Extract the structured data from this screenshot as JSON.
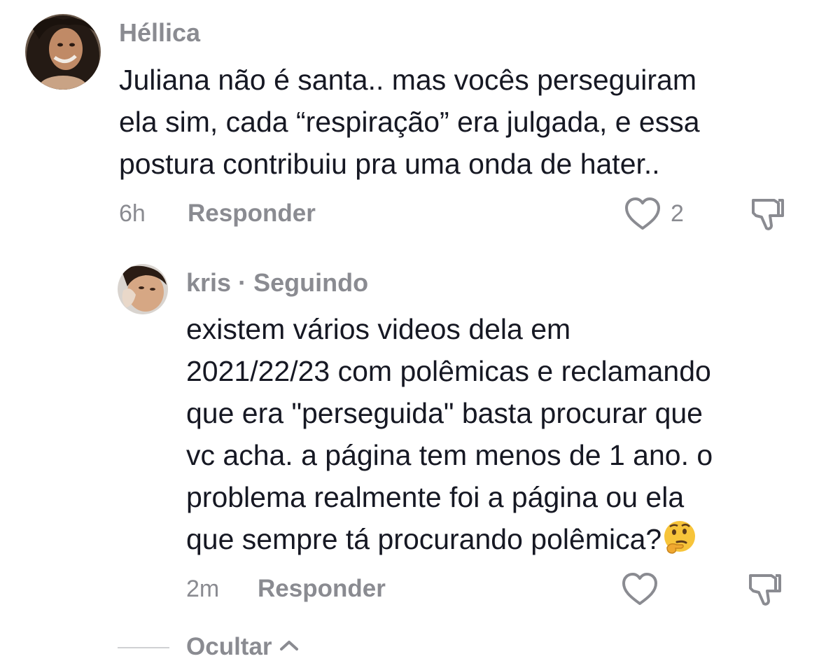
{
  "comment": {
    "author": "Héllica",
    "text": "Juliana não é santa.. mas vocês perseguiram\nela sim, cada “respiração” era julgada, e essa\npostura contribuiu pra uma onda de hater..",
    "time": "6h",
    "reply_label": "Responder",
    "likes": "2",
    "icons": {
      "like": "heart-outline-icon",
      "dislike": "thumbs-down-icon"
    }
  },
  "reply": {
    "author": "kris",
    "separator": "·",
    "status": "Seguindo",
    "text": "existem vários videos dela em\n2021/22/23 com polêmicas e reclamando\nque era \"perseguida\" basta procurar que\nvc acha. a página tem menos de 1 ano. o\nproblema realmente foi a página ou ela\nque sempre tá procurando polêmica?",
    "emoji": "thinking-face-emoji",
    "time": "2m",
    "reply_label": "Responder",
    "icons": {
      "like": "heart-outline-icon",
      "dislike": "thumbs-down-icon"
    }
  },
  "hide_replies": {
    "label": "Ocultar",
    "icon": "chevron-up-icon"
  },
  "colors": {
    "text": "#161823",
    "secondary": "#8a8b91",
    "divider": "#d0d1d3"
  }
}
